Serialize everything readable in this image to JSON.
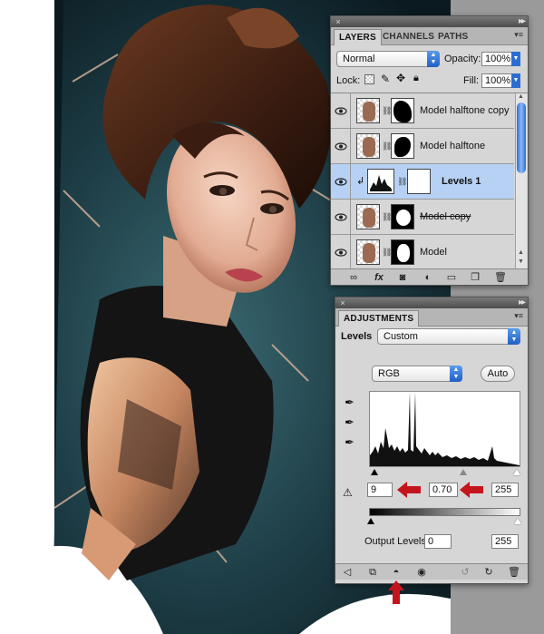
{
  "colors": {
    "accent": "#2c6dd4",
    "selected_row": "#b7d1f5",
    "panel_bg": "#d6d6d6",
    "arrow_red": "#c4151c"
  },
  "layers_panel": {
    "tabs": [
      {
        "label": "LAYERS",
        "active": true
      },
      {
        "label": "CHANNELS",
        "active": false
      },
      {
        "label": "PATHS",
        "active": false
      }
    ],
    "blend_mode": "Normal",
    "opacity_label": "Opacity:",
    "opacity_value": "100%",
    "lock_label": "Lock:",
    "fill_label": "Fill:",
    "fill_value": "100%",
    "layers": [
      {
        "name": "Model halftone copy",
        "selected": false,
        "visible": true
      },
      {
        "name": "Model halftone",
        "selected": false,
        "visible": true
      },
      {
        "name": "Levels 1",
        "selected": true,
        "visible": true
      },
      {
        "name": "Model copy",
        "selected": false,
        "visible": true
      },
      {
        "name": "Model",
        "selected": false,
        "visible": true
      }
    ],
    "footer_icons": [
      "link-icon",
      "fx-icon",
      "mask-icon",
      "adjustment-icon",
      "folder-icon",
      "new-layer-icon",
      "trash-icon"
    ]
  },
  "adjustments_panel": {
    "tab_label": "ADJUSTMENTS",
    "title": "Levels",
    "preset": "Custom",
    "channel": "RGB",
    "auto_label": "Auto",
    "input_black": "9",
    "input_gamma": "0.70",
    "input_white": "255",
    "output_label": "Output Levels:",
    "output_black": "0",
    "output_white": "255",
    "footer_icons": [
      "back-icon",
      "clip-icon",
      "visibility-toggle-icon",
      "eye-icon",
      "reset-icon",
      "refresh-icon",
      "trash-icon"
    ]
  }
}
